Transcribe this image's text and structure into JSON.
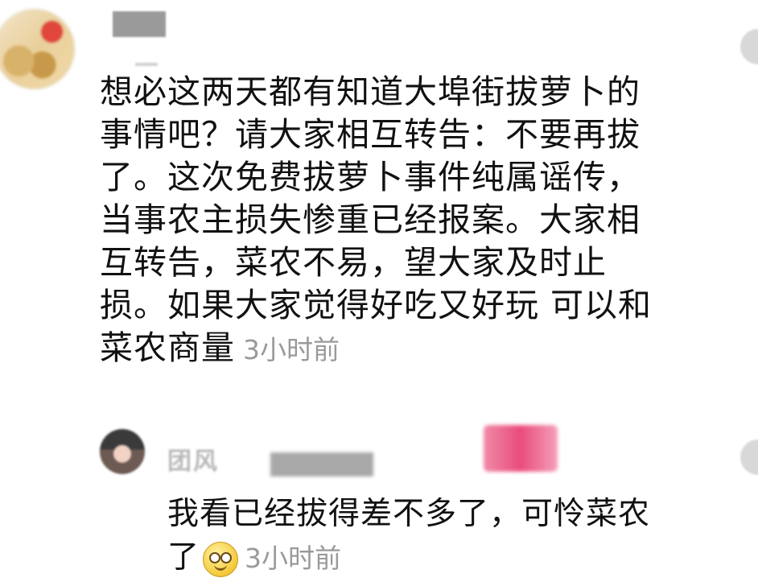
{
  "comment": {
    "lines": [
      "想必这两天都有知道大埠街拔萝卜的",
      "事情吧？请大家相互转告：不要再拔",
      "了。这次免费拔萝卜事件纯属谣传，",
      "当事农主损失惨重已经报案。大家相",
      "互转告，菜农不易，望大家及时止",
      "损。如果大家觉得好吃又好玩 可以和",
      "菜农商量"
    ],
    "time": "3小时前"
  },
  "reply": {
    "author": "团风",
    "lines": [
      "我看已经拔得差不多了，可怜菜农",
      "了"
    ],
    "emoji": "smile-emoji",
    "time": "3小时前"
  }
}
